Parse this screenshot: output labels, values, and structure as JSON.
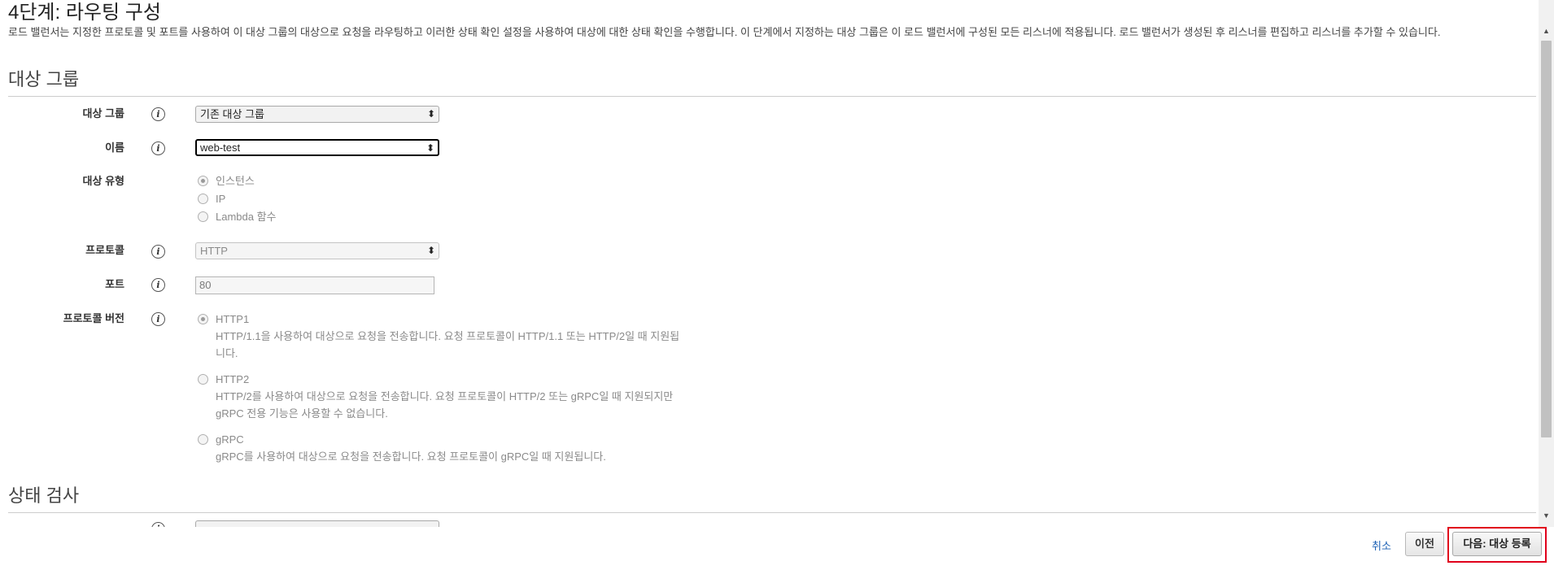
{
  "page": {
    "title": "4단계: 라우팅 구성",
    "description": "로드 밸런서는 지정한 프로토콜 및 포트를 사용하여 이 대상 그룹의 대상으로 요청을 라우팅하고 이러한 상태 확인 설정을 사용하여 대상에 대한 상태 확인을 수행합니다. 이 단계에서 지정하는 대상 그룹은 이 로드 밸런서에 구성된 모든 리스너에 적용됩니다. 로드 밸런서가 생성된 후 리스너를 편집하고 리스너를 추가할 수 있습니다."
  },
  "target_group_section": {
    "heading": "대상 그룹",
    "target_group": {
      "label": "대상 그룹",
      "value": "기존 대상 그룹"
    },
    "name": {
      "label": "이름",
      "value": "web-test"
    },
    "target_type": {
      "label": "대상 유형",
      "options": [
        {
          "label": "인스턴스",
          "checked": true
        },
        {
          "label": "IP",
          "checked": false
        },
        {
          "label": "Lambda 함수",
          "checked": false
        }
      ]
    },
    "protocol": {
      "label": "프로토콜",
      "value": "HTTP"
    },
    "port": {
      "label": "포트",
      "value": "80"
    },
    "protocol_version": {
      "label": "프로토콜 버전",
      "options": [
        {
          "label": "HTTP1",
          "checked": true,
          "description_line1": "HTTP/1.1을 사용하여 대상으로 요청을 전송합니다. 요청 프로토콜이 HTTP/1.1 또는 HTTP/2일 때 지원됩",
          "description_line2": "니다."
        },
        {
          "label": "HTTP2",
          "checked": false,
          "description_line1": "HTTP/2를 사용하여 대상으로 요청을 전송합니다. 요청 프로토콜이 HTTP/2 또는 gRPC일 때 지원되지만",
          "description_line2": "gRPC 전용 기능은 사용할 수 없습니다."
        },
        {
          "label": "gRPC",
          "checked": false,
          "description_line1": "gRPC를 사용하여 대상으로 요청을 전송합니다. 요청 프로토콜이 gRPC일 때 지원됩니다."
        }
      ]
    }
  },
  "health_check_section": {
    "heading": "상태 검사"
  },
  "icons": {
    "info": "i",
    "select_arrow": "⬍",
    "scroll_up": "▲",
    "scroll_down": "▼"
  },
  "footer": {
    "cancel_label": "취소",
    "previous_label": "이전",
    "next_label": "다음: 대상 등록"
  },
  "colors": {
    "highlight": "#e0001b",
    "link": "#1a5fb4"
  }
}
